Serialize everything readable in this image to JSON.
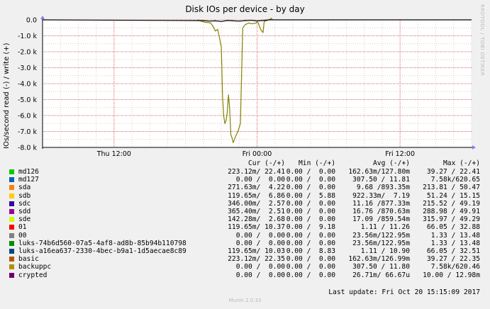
{
  "chart_data": {
    "type": "line",
    "title": "Disk IOs per device - by day",
    "ylabel": "IOs/second read (-) / write (+)",
    "ylim": [
      -8000,
      0
    ],
    "yticks": [
      {
        "value": 0,
        "label": "0.0"
      },
      {
        "value": -1000,
        "label": "-1.0 k"
      },
      {
        "value": -2000,
        "label": "-2.0 k"
      },
      {
        "value": -3000,
        "label": "-3.0 k"
      },
      {
        "value": -4000,
        "label": "-4.0 k"
      },
      {
        "value": -5000,
        "label": "-5.0 k"
      },
      {
        "value": -6000,
        "label": "-6.0 k"
      },
      {
        "value": -7000,
        "label": "-7.0 k"
      },
      {
        "value": -8000,
        "label": "-8.0 k"
      }
    ],
    "xlim": [
      0,
      36
    ],
    "xticks": [
      {
        "value": 6,
        "label": "Thu 12:00"
      },
      {
        "value": 18,
        "label": "Fri 00:00"
      },
      {
        "value": 30,
        "label": "Fri 12:00"
      }
    ],
    "grid": true,
    "series": [
      {
        "name": "backuppc",
        "color": "#828200",
        "x": [
          13.0,
          13.3,
          13.6,
          14.0,
          14.1,
          14.3,
          14.5,
          14.7,
          15.0,
          15.1,
          15.2,
          15.3,
          15.4,
          15.5,
          15.6,
          15.7,
          15.8,
          15.9,
          16.0,
          16.1,
          16.2,
          16.4,
          16.6,
          16.8,
          17.0,
          17.3,
          17.6,
          17.9,
          18.0,
          18.1,
          18.3,
          18.5,
          18.6,
          18.8,
          19.0,
          19.2,
          19.3
        ],
        "y": [
          0,
          -80,
          -150,
          -180,
          -200,
          -400,
          -700,
          -600,
          -1700,
          -4800,
          -6000,
          -6500,
          -6300,
          -5800,
          -4700,
          -5500,
          -7200,
          -7400,
          -7700,
          -7500,
          -7300,
          -7000,
          -6500,
          -500,
          -300,
          -200,
          -250,
          -200,
          -150,
          -200,
          -600,
          -800,
          -100,
          -50,
          0,
          100,
          0
        ]
      },
      {
        "name": "basic",
        "color": "#000000",
        "x": [
          0,
          13.5,
          14.0,
          14.5,
          15.0,
          15.5,
          16.0,
          16.5,
          17.0,
          17.5,
          18.0,
          18.5,
          19.0,
          36
        ],
        "y": [
          0,
          -50,
          -80,
          -60,
          -100,
          -40,
          -60,
          -80,
          -50,
          -30,
          -70,
          -40,
          0,
          0
        ]
      }
    ],
    "legend_header": {
      "cur": "Cur (-/+)",
      "min": "Min (-/+)",
      "avg": "Avg (-/+)",
      "max": "Max (-/+)"
    },
    "legend": [
      {
        "name": "md126",
        "color": "#00cc00",
        "cur": "223.12m/ 22.41",
        "min": "0.00 /  0.00",
        "avg": "162.63m/127.80m",
        "max": "39.27 / 22.41"
      },
      {
        "name": "md127",
        "color": "#0066b3",
        "cur": "0.00 /  0.00",
        "min": "0.00 /  0.00",
        "avg": "307.50 / 11.81",
        "max": "7.58k/620.65"
      },
      {
        "name": "sda",
        "color": "#ff8000",
        "cur": "271.63m/  4.22",
        "min": "0.00 /  0.00",
        "avg": "9.68 /893.35m",
        "max": "213.81 / 50.47"
      },
      {
        "name": "sdb",
        "color": "#ffcc00",
        "cur": "119.65m/  6.86",
        "min": "0.00 /  5.88",
        "avg": "922.33m/  7.19",
        "max": "51.24 / 15.15"
      },
      {
        "name": "sdc",
        "color": "#330099",
        "cur": "346.00m/  2.57",
        "min": "0.00 /  0.00",
        "avg": "11.16 /877.33m",
        "max": "215.52 / 49.19"
      },
      {
        "name": "sdd",
        "color": "#990099",
        "cur": "365.40m/  2.51",
        "min": "0.00 /  0.00",
        "avg": "16.76 /870.63m",
        "max": "288.98 / 49.91"
      },
      {
        "name": "sde",
        "color": "#ccff00",
        "cur": "142.28m/  2.68",
        "min": "0.00 /  0.00",
        "avg": "17.09 /859.54m",
        "max": "315.97 / 49.29"
      },
      {
        "name": "01",
        "color": "#ff0000",
        "cur": "119.65m/ 10.37",
        "min": "0.00 /  9.18",
        "avg": "1.11 / 11.26",
        "max": "66.05 / 32.88"
      },
      {
        "name": "00",
        "color": "#808080",
        "cur": "0.00 /  0.00",
        "min": "0.00 /  0.00",
        "avg": "23.56m/122.95m",
        "max": "1.33 / 13.48"
      },
      {
        "name": "luks-74b6d560-07a5-4af8-ad8b-85b94b110798",
        "color": "#008f00",
        "cur": "0.00 /  0.00",
        "min": "0.00 /  0.00",
        "avg": "23.56m/122.95m",
        "max": "1.33 / 13.48"
      },
      {
        "name": "luks-a16ea637-2330-4bec-b9a1-1d5aecae8c89",
        "color": "#00487d",
        "cur": "119.65m/ 10.03",
        "min": "0.00 /  8.83",
        "avg": "1.11 / 10.90",
        "max": "66.05 / 32.51"
      },
      {
        "name": "basic",
        "color": "#b35a00",
        "cur": "223.12m/ 22.35",
        "min": "0.00 /  0.00",
        "avg": "162.63m/126.99m",
        "max": "39.27 / 22.35"
      },
      {
        "name": "backuppc",
        "color": "#b38f00",
        "cur": "0.00 /  0.00",
        "min": "0.00 /  0.00",
        "avg": "307.50 / 11.80",
        "max": "7.58k/620.46"
      },
      {
        "name": "crypted",
        "color": "#6b006b",
        "cur": "0.00 /  0.00",
        "min": "0.00 /  0.00",
        "avg": "26.71m/ 66.67u",
        "max": "10.00 / 12.98m"
      }
    ]
  },
  "sidebar_text": "RRDTOOL / TOBI OETIKER",
  "last_update": "Last update:  Fri Oct 20 15:15:09 2017",
  "footer": "Munin 2.0.33"
}
